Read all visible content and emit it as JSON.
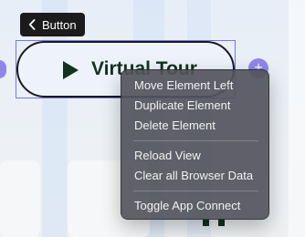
{
  "tooltip": {
    "icon": "chevron-left-icon",
    "label": "Button"
  },
  "selected_element": {
    "icon": "play-icon",
    "label": "Virtual Tour",
    "handle_right_symbol": "+"
  },
  "context_menu": {
    "groups": [
      [
        "Move Element Left",
        "Duplicate Element",
        "Delete Element"
      ],
      [
        "Reload View",
        "Clear all Browser Data"
      ],
      [
        "Toggle App Connect"
      ]
    ]
  }
}
